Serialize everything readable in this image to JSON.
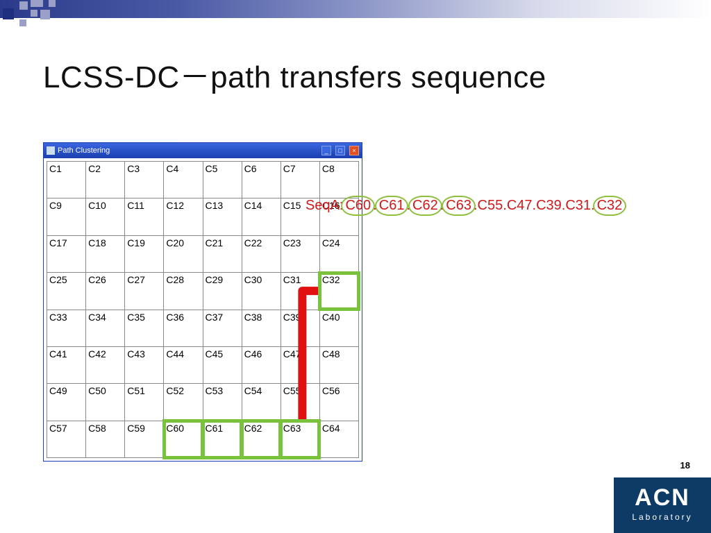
{
  "slide": {
    "title": "LCSS-DC－path transfers sequence",
    "page_number": "18"
  },
  "window": {
    "title": "Path Clustering"
  },
  "grid": {
    "cols": 8,
    "rows": 8,
    "cells": [
      [
        "C1",
        "C2",
        "C3",
        "C4",
        "C5",
        "C6",
        "C7",
        "C8"
      ],
      [
        "C9",
        "C10",
        "C11",
        "C12",
        "C13",
        "C14",
        "C15",
        "C16"
      ],
      [
        "C17",
        "C18",
        "C19",
        "C20",
        "C21",
        "C22",
        "C23",
        "C24"
      ],
      [
        "C25",
        "C26",
        "C27",
        "C28",
        "C29",
        "C30",
        "C31",
        "C32"
      ],
      [
        "C33",
        "C34",
        "C35",
        "C36",
        "C37",
        "C38",
        "C39",
        "C40"
      ],
      [
        "C41",
        "C42",
        "C43",
        "C44",
        "C45",
        "C46",
        "C47",
        "C48"
      ],
      [
        "C49",
        "C50",
        "C51",
        "C52",
        "C53",
        "C54",
        "C55",
        "C56"
      ],
      [
        "C57",
        "C58",
        "C59",
        "C60",
        "C61",
        "C62",
        "C63",
        "C64"
      ]
    ],
    "shaded": [
      "C1",
      "C15",
      "C17",
      "C20",
      "C36",
      "C50",
      "C60",
      "C64"
    ],
    "green_border": [
      "C32",
      "C60",
      "C61",
      "C62",
      "C63"
    ]
  },
  "seqa": {
    "prefix": "SeqA:",
    "tokens": [
      "C60",
      "C61",
      "C62",
      "C63",
      "C55",
      "C47",
      "C39",
      "C31",
      "C32"
    ],
    "circled": [
      "C60",
      "C61",
      "C62",
      "C63",
      "C32"
    ]
  },
  "logo": {
    "name": "ACN",
    "sub": "Laboratory"
  }
}
